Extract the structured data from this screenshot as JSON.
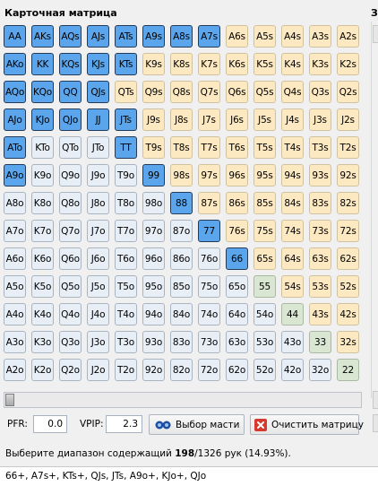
{
  "title": "Карточная матрица",
  "side_title_fragment": "З",
  "ranks": [
    "A",
    "K",
    "Q",
    "J",
    "T",
    "9",
    "8",
    "7",
    "6",
    "5",
    "4",
    "3",
    "2"
  ],
  "selected": [
    "AA",
    "AKs",
    "AQs",
    "AJs",
    "ATs",
    "A9s",
    "A8s",
    "A7s",
    "AKo",
    "KK",
    "KQs",
    "KJs",
    "KTs",
    "AQo",
    "KQo",
    "QQ",
    "QJs",
    "AJo",
    "KJo",
    "QJo",
    "JJ",
    "JTs",
    "ATo",
    "TT",
    "A9o",
    "99",
    "88",
    "77",
    "66"
  ],
  "colors": {
    "selected": "#5ba5ec",
    "pair": "#d8e6d2",
    "suited": "#fde9c1",
    "offsuit": "#e8eef5"
  },
  "controls": {
    "pfr_label": "PFR:",
    "pfr_value": "0.0",
    "vpip_label": "VPIP:",
    "vpip_value": "2.3",
    "suit_button_label": "Выбор масти",
    "suit_button_icon": "cards-icon",
    "clear_button_label": "Очистить матрицу",
    "clear_button_icon": "close-icon"
  },
  "status": {
    "prefix": "Выберите диапазон содержащий ",
    "count": "198",
    "suffix": "/1326 рук (14.93%)."
  },
  "range_text": "66+, A7s+, KTs+, QJs, JTs, A9o+, KJo+, QJo"
}
